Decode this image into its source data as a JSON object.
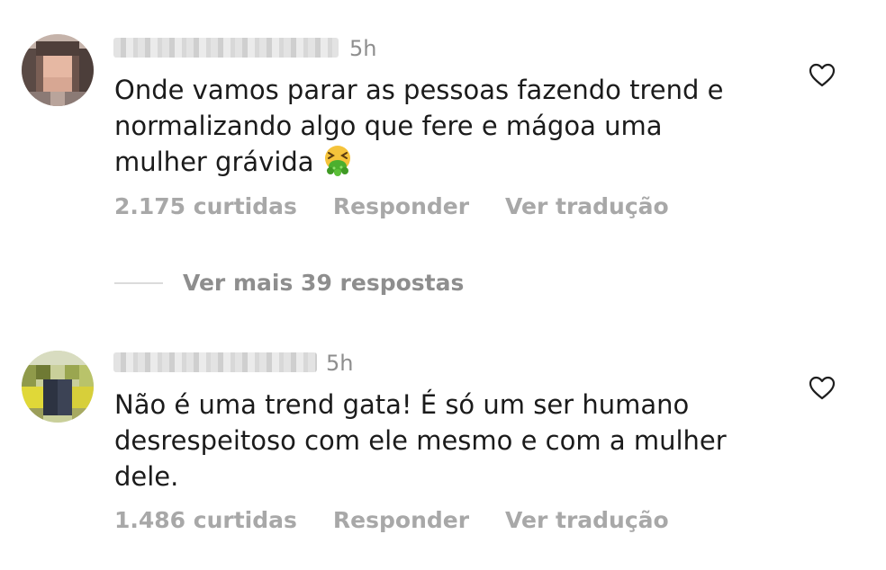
{
  "comments": [
    {
      "time": "5h",
      "text": "Onde vamos parar as pessoas fazendo trend e\nnormalizando algo que fere e mágoa uma\nmulher grávida",
      "emoji": "nauseated-vomiting-face-icon",
      "likes": "2.175 curtidas",
      "reply": "Responder",
      "translate": "Ver tradução"
    },
    {
      "time": "5h",
      "text": "Não é uma trend gata! É só um ser humano\ndesrespeitoso com ele mesmo e com a mulher\ndele.",
      "likes": "1.486 curtidas",
      "reply": "Responder",
      "translate": "Ver tradução"
    }
  ],
  "more_replies": "Ver mais 39 respostas",
  "colors": {
    "text": "#1b1b1b",
    "secondary": "#8e8e8e",
    "actions": "#a8a8a8",
    "divider": "#dbdbdb"
  }
}
